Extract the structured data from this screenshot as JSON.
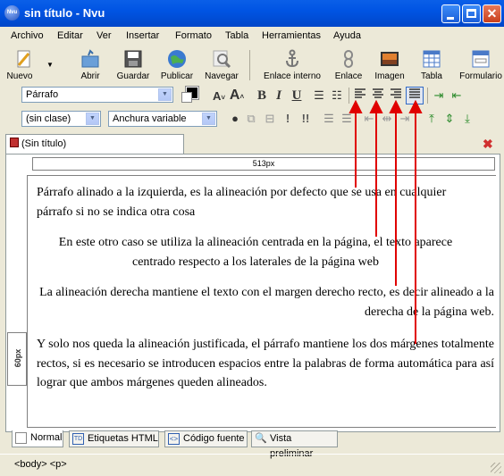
{
  "window": {
    "title": "sin título - Nvu",
    "app_icon": "Nvu"
  },
  "menu": [
    "Archivo",
    "Editar",
    "Ver",
    "Insertar",
    "Formato",
    "Tabla",
    "Herramientas",
    "Ayuda"
  ],
  "toolbar": {
    "nuevo": "Nuevo",
    "abrir": "Abrir",
    "guardar": "Guardar",
    "publicar": "Publicar",
    "navegar": "Navegar",
    "enlace_interno": "Enlace interno",
    "enlace": "Enlace",
    "imagen": "Imagen",
    "tabla": "Tabla",
    "formulario": "Formulario"
  },
  "format": {
    "paragraph_style": "Párrafo",
    "class": "(sin clase)",
    "font_width": "Anchura variable",
    "bold": "B",
    "italic": "I",
    "underline": "U"
  },
  "doc_tab": {
    "label": "(Sin título)"
  },
  "ruler": {
    "width_label": "513px",
    "height_label": "60px"
  },
  "paragraphs": {
    "p1": "Párrafo alinado a la izquierda, es la alineación por defecto que se usa en cualquier párrafo si no se indica otra cosa",
    "p2": "En este otro caso se utiliza la alineación centrada en la página, el texto aparece centrado respecto a los laterales de la página web",
    "p3": "La alineación derecha mantiene el texto con el margen derecho recto, es decir alineado a la derecha de la página web.",
    "p4": "Y solo nos queda la alineación justificada, el párrafo mantiene los dos márgenes totalmente rectos, si es necesario se introducen espacios entre la palabras de forma automática para así lograr que ambos márgenes queden alineados."
  },
  "mode_tabs": [
    "Normal",
    "Etiquetas HTML",
    "Código fuente",
    "Vista preliminar"
  ],
  "status": {
    "path": "<body> <p>"
  },
  "colors": {
    "annotation_arrows": "#e00000",
    "title_bar": "#0054e3"
  }
}
